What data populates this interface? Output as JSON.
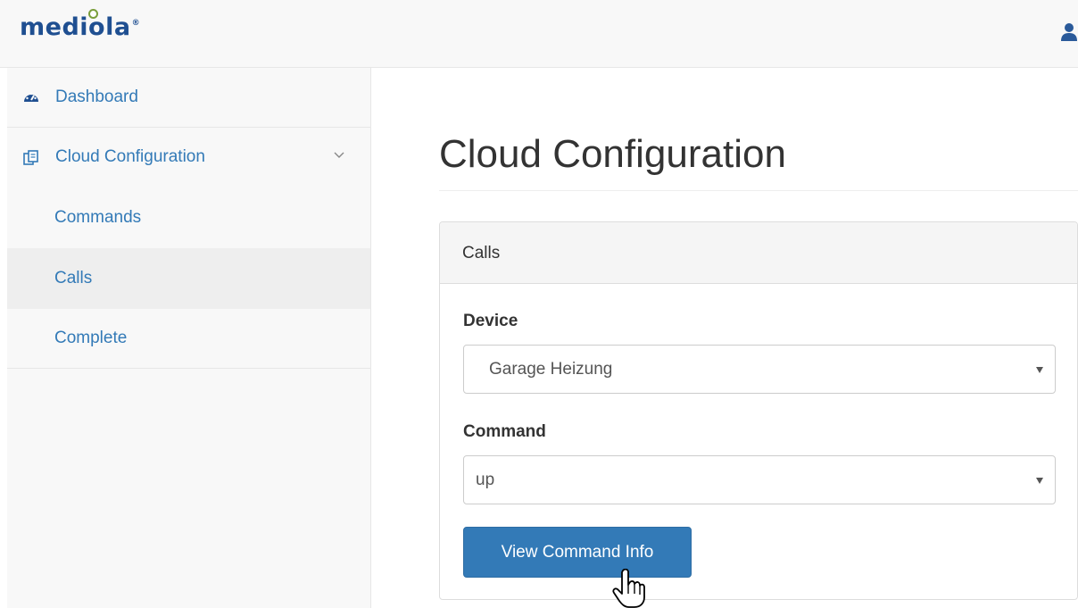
{
  "app": {
    "logo_text": "mediola",
    "logo_reg": "®",
    "brand_color": "#1f4f91"
  },
  "icons": {
    "user": "user-icon",
    "dashboard": "tachometer-icon",
    "cloud_config": "copy-icon",
    "expand": "chevron-down-icon",
    "select_caret": "caret-down-icon",
    "pointer": "hand-pointer-cursor"
  },
  "sidebar": {
    "items": [
      {
        "label": "Dashboard",
        "icon": "tachometer-icon"
      },
      {
        "label": "Cloud Configuration",
        "icon": "copy-icon",
        "expanded": true
      },
      {
        "label": "Commands"
      },
      {
        "label": "Calls",
        "active": true
      },
      {
        "label": "Complete"
      }
    ],
    "link_color": "#337ab7"
  },
  "main": {
    "title": "Cloud Configuration",
    "panel": {
      "heading": "Calls",
      "device": {
        "label": "Device",
        "value": "Garage Heizung"
      },
      "command": {
        "label": "Command",
        "value": "up"
      },
      "button_label": "View Command Info",
      "button_color": "#337ab7"
    }
  }
}
